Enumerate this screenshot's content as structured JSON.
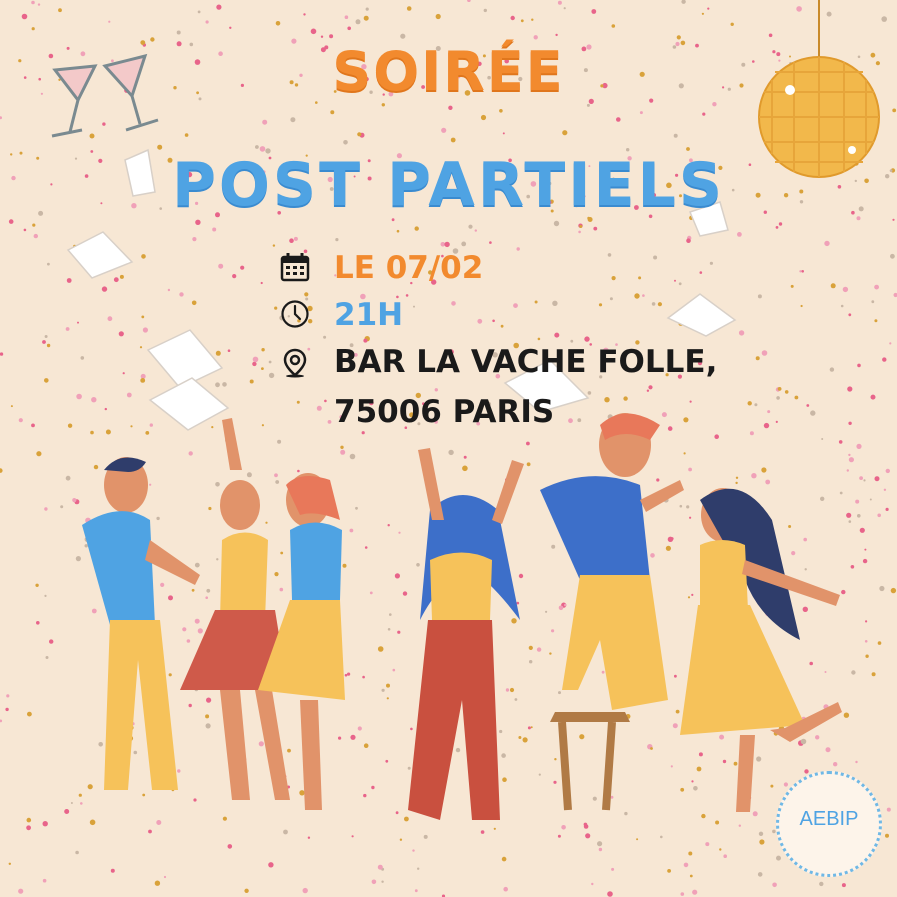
{
  "title_line1": "SOIRÉE",
  "title_line2": "POST PARTIELS",
  "event": {
    "date": "LE 07/02",
    "time": "21H",
    "address_line1": "BAR LA VACHE FOLLE,",
    "address_line2": "75006 PARIS"
  },
  "icons": {
    "date": "calendar-icon",
    "time": "clock-icon",
    "place": "map-pin-icon"
  },
  "logo": {
    "name": "AEBIP"
  },
  "colors": {
    "background": "#f7e7d4",
    "orange": "#f28a2e",
    "blue": "#4fa3e3",
    "dark": "#1a1a1a"
  }
}
